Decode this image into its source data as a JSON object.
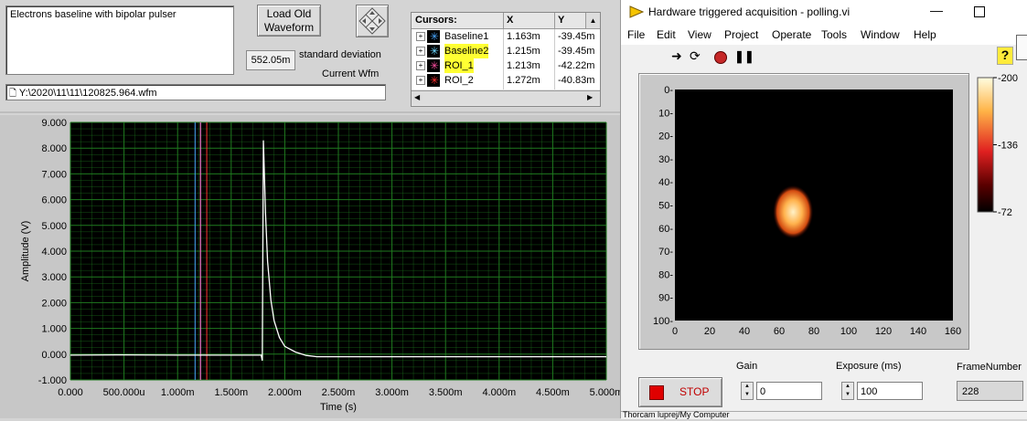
{
  "left": {
    "description": "Electrons baseline with bipolar pulser",
    "load_button": "Load Old\nWaveform",
    "std_value": "552.05m",
    "std_label": "standard deviation",
    "current_wfm_label": "Current Wfm",
    "file_path": "Y:\\2020\\11\\11\\120825.964.wfm",
    "cursor_table": {
      "headers": [
        "Cursors:",
        "X",
        "Y"
      ],
      "rows": [
        {
          "name": "Baseline1",
          "x": "1.163m",
          "y": "-39.45m",
          "color": "#4aa6ff",
          "highlight": false
        },
        {
          "name": "Baseline2",
          "x": "1.215m",
          "y": "-39.45m",
          "color": "#6fd8ff",
          "highlight": true
        },
        {
          "name": "ROI_1",
          "x": "1.213m",
          "y": "-42.22m",
          "color": "#ff4fa0",
          "highlight": true
        },
        {
          "name": "ROI_2",
          "x": "1.272m",
          "y": "-40.83m",
          "color": "#ff3030",
          "highlight": false
        }
      ]
    }
  },
  "graph": {
    "xlabel": "Time (s)",
    "ylabel": "Amplitude (V)",
    "x_ticks": [
      "0.000",
      "500.000u",
      "1.000m",
      "1.500m",
      "2.000m",
      "2.500m",
      "3.000m",
      "3.500m",
      "4.000m",
      "4.500m",
      "5.000m"
    ],
    "y_ticks": [
      "9.000",
      "8.000",
      "7.000",
      "6.000",
      "5.000",
      "4.000",
      "3.000",
      "2.000",
      "1.000",
      "0.000",
      "-1.000"
    ],
    "colors": {
      "plot_bg": "#000000",
      "grid": "#1f7a1f",
      "trace": "#ffffff"
    }
  },
  "chart_data": {
    "type": "line",
    "xlabel": "Time (s)",
    "ylabel": "Amplitude (V)",
    "xlim": [
      0,
      0.005
    ],
    "ylim": [
      -1,
      9
    ],
    "grid": true,
    "series": [
      {
        "x": [
          0,
          0.0005,
          0.001,
          0.0015,
          0.00178,
          0.00179,
          0.0018,
          0.00181,
          0.00182,
          0.00184,
          0.00187,
          0.0019,
          0.00195,
          0.002,
          0.0021,
          0.0022,
          0.0023,
          0.0025,
          0.0027,
          0.003,
          0.0035,
          0.004,
          0.0045,
          0.005
        ],
        "y": [
          -0.04,
          -0.03,
          -0.04,
          -0.04,
          -0.04,
          -0.25,
          8.3,
          7.0,
          5.5,
          3.6,
          2.1,
          1.3,
          0.65,
          0.3,
          0.08,
          -0.05,
          -0.1,
          -0.1,
          -0.1,
          -0.1,
          -0.1,
          -0.1,
          -0.1,
          -0.1
        ]
      }
    ],
    "cursors": [
      {
        "name": "Baseline1",
        "x": 0.001163,
        "color": "#4aa6ff"
      },
      {
        "name": "Baseline2",
        "x": 0.001215,
        "color": "#6fd8ff"
      },
      {
        "name": "ROI_1",
        "x": 0.001213,
        "color": "#ff4fa0"
      },
      {
        "name": "ROI_2",
        "x": 0.001272,
        "color": "#ff3030"
      }
    ]
  },
  "right": {
    "title": "Hardware triggered acquisition - polling.vi",
    "menu": [
      "File",
      "Edit",
      "View",
      "Project",
      "Operate",
      "Tools",
      "Window",
      "Help"
    ],
    "image": {
      "x_ticks": [
        "0",
        "20",
        "40",
        "60",
        "80",
        "100",
        "120",
        "140",
        "160"
      ],
      "y_ticks": [
        "0-",
        "10-",
        "20-",
        "30-",
        "40-",
        "50-",
        "60-",
        "70-",
        "80-",
        "90-",
        "100-"
      ],
      "x_range": [
        0,
        160
      ],
      "y_range": [
        0,
        100
      ],
      "spot_center": [
        68,
        53
      ],
      "spot_radius": 11
    },
    "colorbar_ticks": [
      "-200",
      "-136",
      "-72"
    ],
    "gain_label": "Gain",
    "gain_value": "0",
    "exposure_label": "Exposure (ms)",
    "exposure_value": "100",
    "frame_label": "FrameNumber",
    "frame_value": "228",
    "stop_label": "STOP",
    "status_text": "Thorcam luprej/My Computer"
  }
}
